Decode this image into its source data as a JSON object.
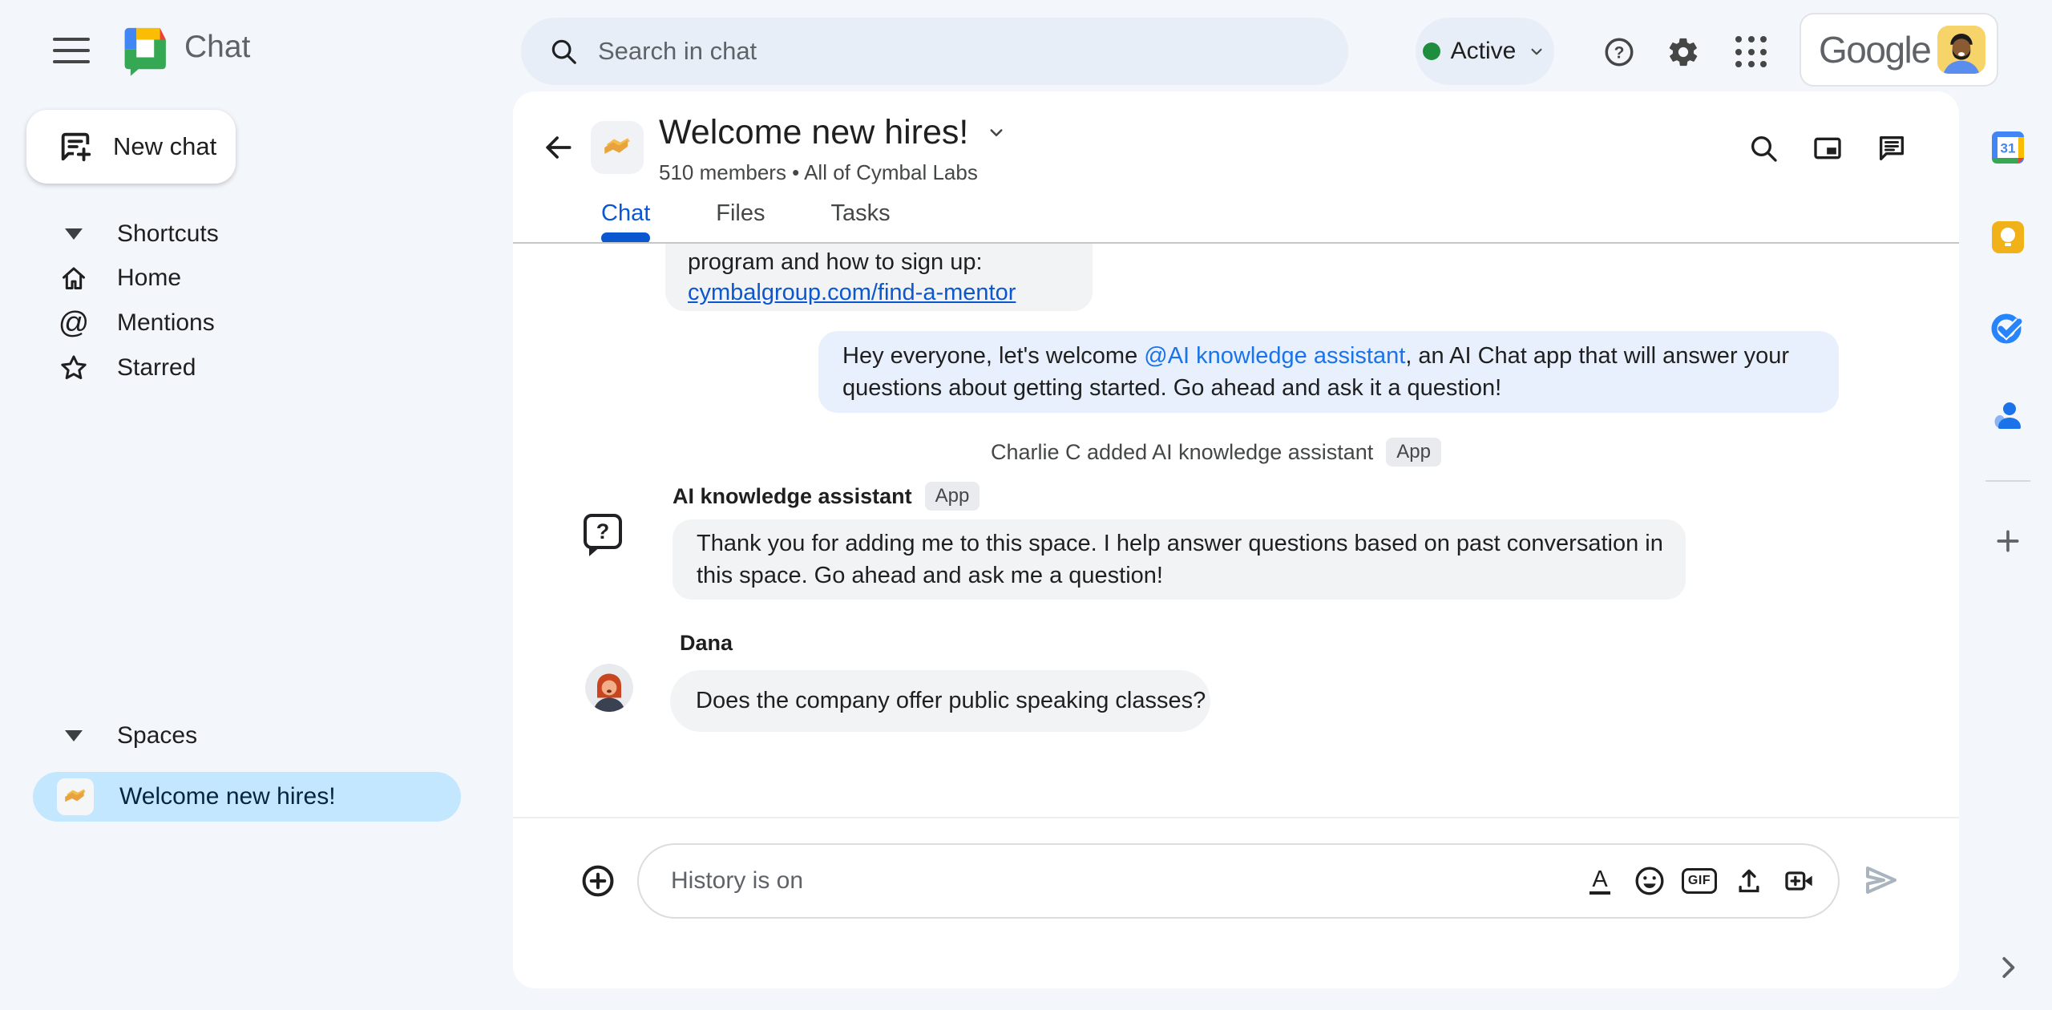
{
  "topbar": {
    "app_name": "Chat",
    "search_placeholder": "Search in chat",
    "status_label": "Active",
    "account_wordmark": "Google"
  },
  "sidebar": {
    "new_chat_label": "New chat",
    "shortcuts": {
      "label": "Shortcuts",
      "items": [
        {
          "label": "Home"
        },
        {
          "label": "Mentions"
        },
        {
          "label": "Starred"
        }
      ]
    },
    "spaces": {
      "label": "Spaces",
      "items": [
        {
          "label": "Welcome new hires!",
          "selected": true
        }
      ]
    }
  },
  "space_header": {
    "title": "Welcome new hires!",
    "subtitle": "510 members • All of Cymbal Labs",
    "tabs": [
      {
        "label": "Chat"
      },
      {
        "label": "Files"
      },
      {
        "label": "Tasks"
      }
    ],
    "active_tab": "Chat"
  },
  "conversation": {
    "clipped_message": {
      "text": "program and how to sign up:",
      "link": "cymbalgroup.com/find-a-mentor"
    },
    "welcome_message": {
      "pre": "Hey everyone, let's welcome ",
      "mention": "@AI knowledge assistant",
      "rest_line1": ", an AI Chat app that will answer your",
      "line2": "questions about getting started.  Go ahead and ask it a question!"
    },
    "system_event": {
      "text": "Charlie C added AI knowledge assistant",
      "badge": "App"
    },
    "assistant_message": {
      "sender": "AI knowledge assistant",
      "badge": "App",
      "line1": "Thank you for adding me to this space. I help answer questions based on past conversation in",
      "line2": "this space. Go ahead and ask me a question!"
    },
    "user_message": {
      "sender": "Dana",
      "text": "Does the company offer public speaking classes?"
    }
  },
  "composer": {
    "placeholder": "History is on",
    "gif_label": "GIF"
  },
  "icons": {
    "calendar_day": "31",
    "help_glyph": "?",
    "at_glyph": "@",
    "format_glyph": "A",
    "ai_avatar_glyph": "?"
  },
  "colors": {
    "accent_blue": "#0b57d0",
    "mention_blue": "#1a73e8",
    "selected_space_bg": "#c2e7ff",
    "blue_bubble_bg": "#e8f0fe",
    "grey_bubble_bg": "#f1f3f4",
    "pill_bg": "#e8eef7",
    "status_green": "#1e8e3e",
    "page_bg": "#f3f6fb"
  }
}
